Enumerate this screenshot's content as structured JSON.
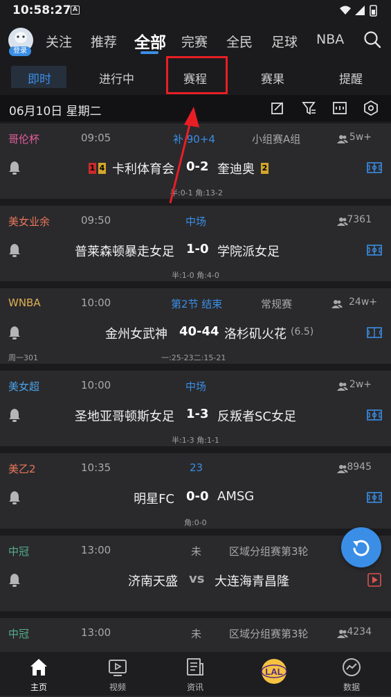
{
  "status_bar": {
    "time": "10:58:27",
    "app_icon": "A"
  },
  "top_nav": {
    "login_badge": "登录",
    "tabs": [
      "关注",
      "推荐",
      "全部",
      "完赛",
      "全民",
      "足球",
      "NBA"
    ],
    "active_tab": "全部"
  },
  "sub_tabs": {
    "items": [
      "即时",
      "进行中",
      "赛程",
      "赛果",
      "提醒"
    ],
    "active": "即时"
  },
  "date_bar": {
    "date": "06月10日 星期二"
  },
  "colors": {
    "accent": "#3a8ee6",
    "highlight": "#e81e25"
  },
  "matches": [
    {
      "league": "哥伦杯",
      "league_color": "#e45e9b",
      "time": "09:05",
      "status": "补 90+4",
      "round": "小组赛A组",
      "viewers": "5w+",
      "home": "卡利体育会",
      "score": "0-2",
      "away": "奎迪奥",
      "home_cards": [
        "1",
        "4"
      ],
      "away_card": "2",
      "sub": "半:0-1 角:13-2"
    },
    {
      "league": "美女业余",
      "league_color": "#e8775a",
      "time": "09:50",
      "status": "中场",
      "round": "",
      "viewers": "7361",
      "home": "普莱森顿暴走女足",
      "score": "1-0",
      "away": "学院派女足",
      "sub": "半:1-0 角:4-0"
    },
    {
      "league": "WNBA",
      "league_color": "#e0b050",
      "time": "10:00",
      "status": "第2节 结束",
      "round": "常规赛",
      "viewers": "24w+",
      "home": "金州女武神",
      "score": "40-44",
      "away": "洛杉矶火花",
      "odds": "(6.5)",
      "weekday": "周一301",
      "sub": "一:25-23二:15-21"
    },
    {
      "league": "美女超",
      "league_color": "#4aa3e8",
      "time": "10:00",
      "status": "中场",
      "round": "",
      "viewers": "2w+",
      "home": "圣地亚哥顿斯女足",
      "score": "1-3",
      "away": "反叛者SC女足",
      "sub": "半:1-3 角:1-1"
    },
    {
      "league": "美乙2",
      "league_color": "#e8775a",
      "time": "10:35",
      "status": "23",
      "round": "",
      "viewers": "8945",
      "home": "明星FC",
      "score": "0-0",
      "away": "AMSG",
      "sub": "角:0-0"
    },
    {
      "league": "中冠",
      "league_color": "#55b08a",
      "time": "13:00",
      "status": "未",
      "round": "区域分组赛第3轮",
      "viewers": "",
      "home": "济南天盛",
      "score": "vs",
      "away": "大连海青昌隆",
      "sub": ""
    },
    {
      "league": "中冠",
      "league_color": "#55b08a",
      "time": "13:00",
      "status": "未",
      "round": "区域分组赛第3轮",
      "viewers": "4234",
      "home": "",
      "score": "",
      "away": "",
      "sub": ""
    }
  ],
  "bottom_nav": {
    "items": [
      "主页",
      "视频",
      "资讯",
      "",
      "数据"
    ],
    "active": "主页",
    "center_logo": "LAL"
  }
}
